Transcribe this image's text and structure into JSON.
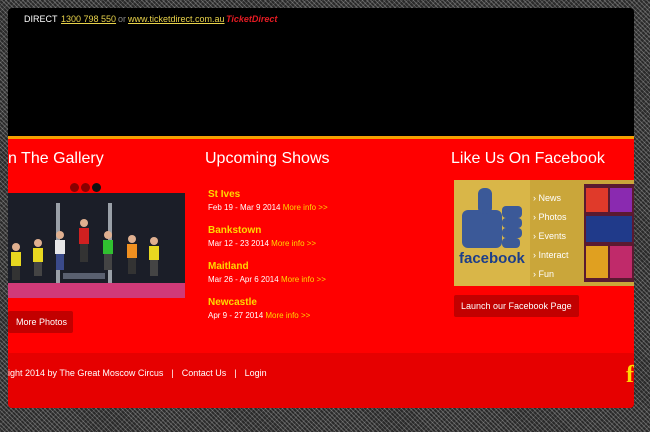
{
  "topbar": {
    "left_text": "DIRECT",
    "phone": "1300 798 550",
    "or": "or",
    "site": "www.ticketdirect.com.au",
    "brand_ticket": "Ticket",
    "brand_direct": "Direct"
  },
  "gallery": {
    "title": "n The Gallery",
    "more_photos_label": "More Photos"
  },
  "shows": {
    "title": "Upcoming Shows",
    "items": [
      {
        "city": "St Ives",
        "dates": "Feb 19 - Mar 9 2014",
        "more": "More info >>"
      },
      {
        "city": "Bankstown",
        "dates": "Mar 12 - 23 2014",
        "more": "More info >>"
      },
      {
        "city": "Maitland",
        "dates": "Mar 26 - Apr 6 2014",
        "more": "More info >>"
      },
      {
        "city": "Newcastle",
        "dates": "Apr 9 - 27 2014",
        "more": "More info >>"
      }
    ]
  },
  "facebook": {
    "title": "Like Us On Facebook",
    "launch_label": "Launch our Facebook Page",
    "image_logo": "facebook",
    "menu": [
      "News",
      "Photos",
      "Events",
      "Interact",
      "Fun"
    ]
  },
  "footer": {
    "copyright": "ight 2014 by The Great Moscow Circus",
    "sep": "|",
    "contact": "Contact Us",
    "login": "Login",
    "fb_icon": "f"
  },
  "colors": {
    "content_bg": "#ff0000",
    "accent_yellow": "#ffd800",
    "orange_rule": "#f5a000",
    "button_bg": "#c20000"
  }
}
